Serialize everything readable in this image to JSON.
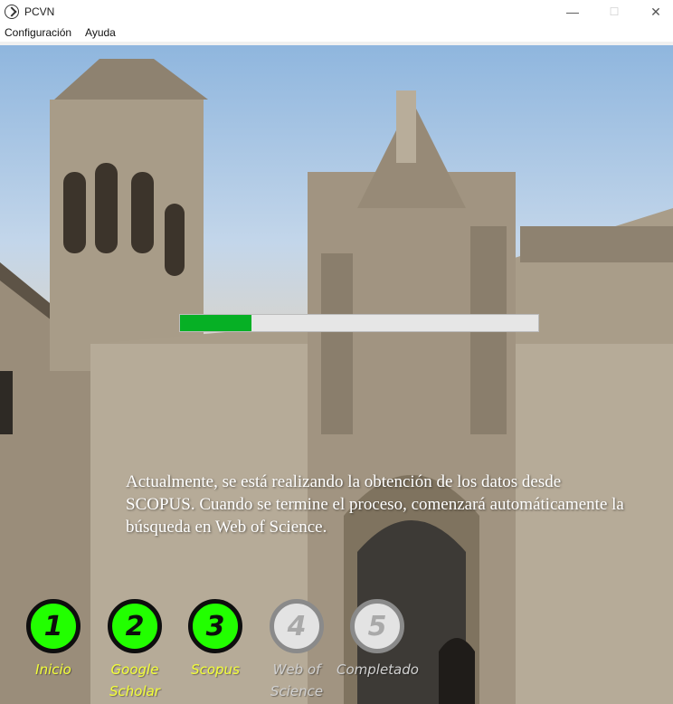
{
  "window": {
    "title": "PCVN",
    "controls": {
      "minimize": "—",
      "maximize": "☐",
      "close": "✕"
    }
  },
  "menu": {
    "items": [
      "Configuración",
      "Ayuda"
    ]
  },
  "progress": {
    "value_percent": 20,
    "color": "#06b025"
  },
  "message": "Actualmente, se está realizando la obtención de los datos desde SCOPUS.  Cuando se termine el proceso, comenzará automáticamente la búsqueda en Web of Science.",
  "steps": [
    {
      "number": "1",
      "label": "Inicio",
      "status": "done"
    },
    {
      "number": "2",
      "label": "Google Scholar",
      "status": "done"
    },
    {
      "number": "3",
      "label": "Scopus",
      "status": "done"
    },
    {
      "number": "4",
      "label": "Web of Science",
      "status": "pending"
    },
    {
      "number": "5",
      "label": "Completado",
      "status": "pending"
    }
  ],
  "colors": {
    "step_done": "#22ff00",
    "step_label_done": "#f3ff38",
    "step_pending": "#e3e3e3"
  }
}
